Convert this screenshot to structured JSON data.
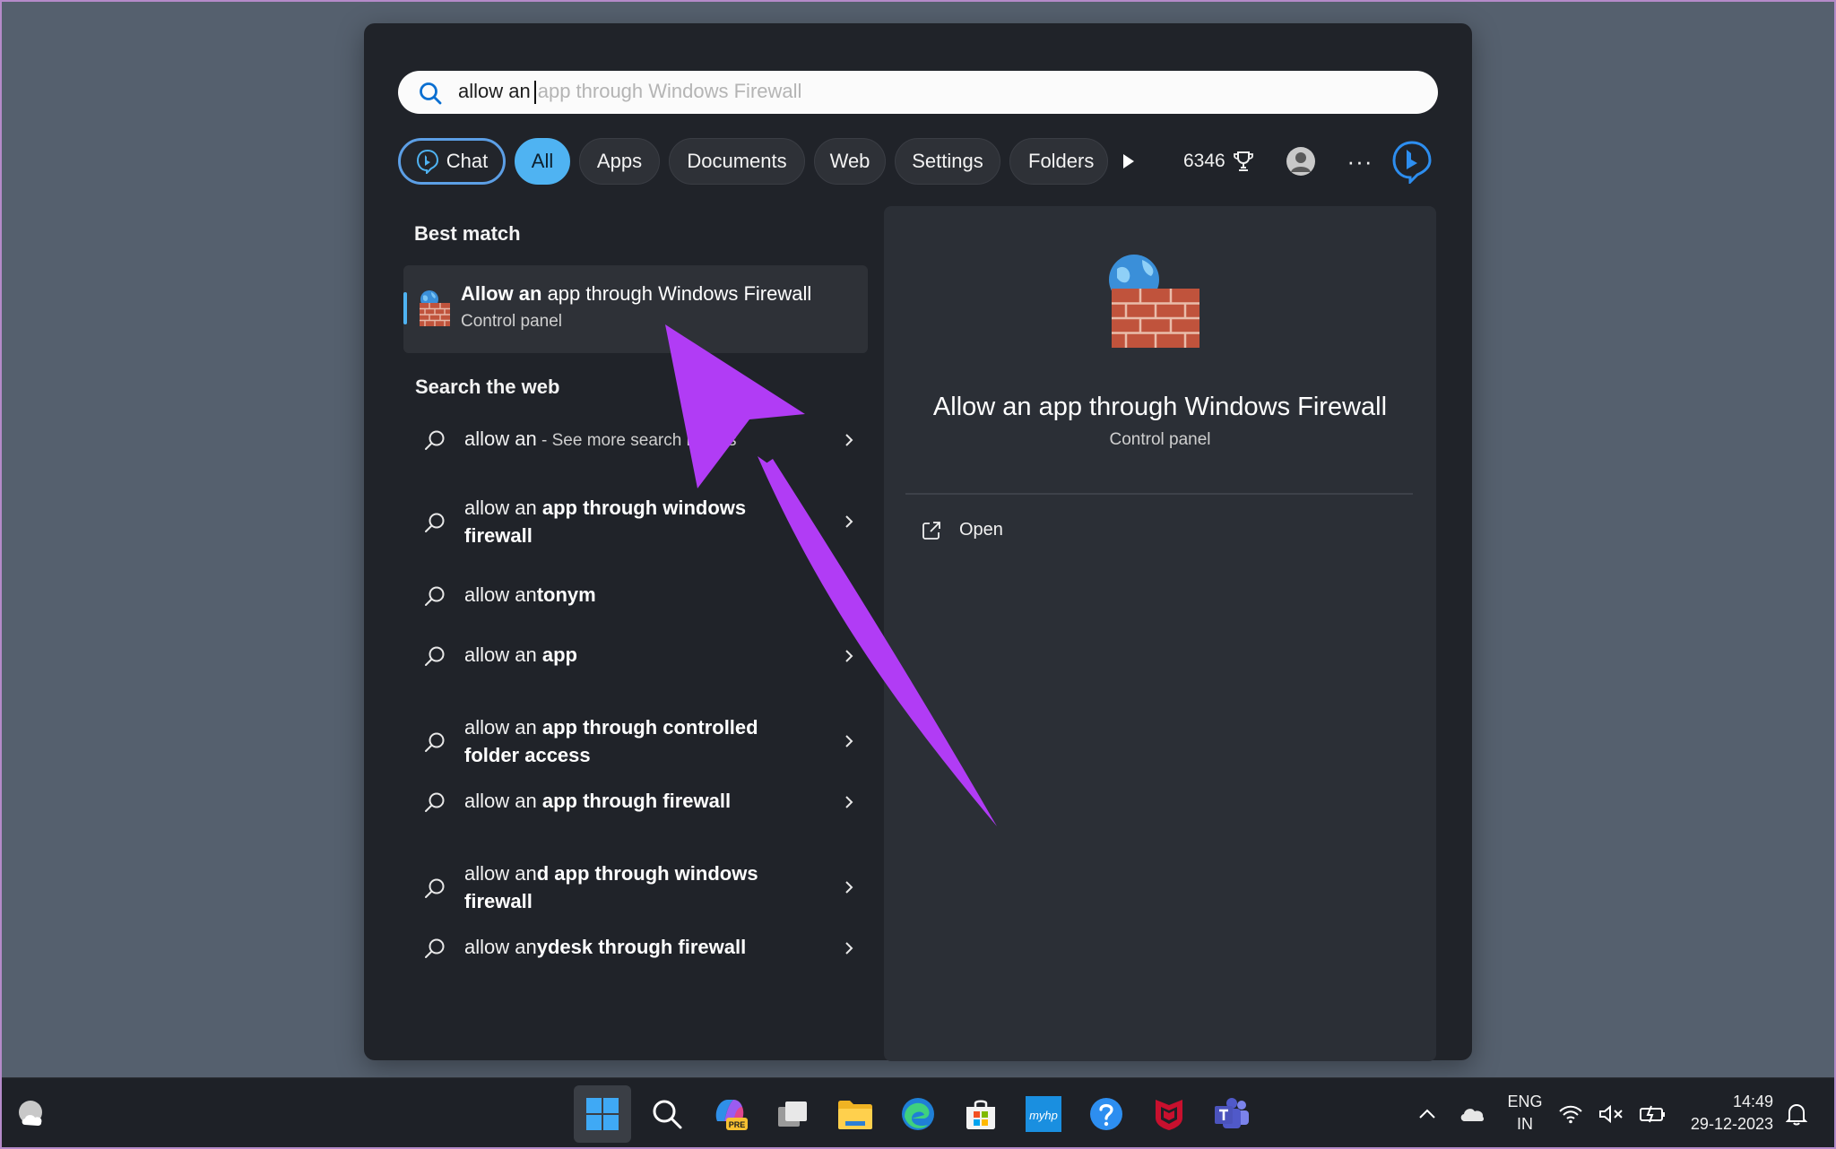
{
  "search": {
    "typed": "allow an",
    "suggestion": "app through Windows Firewall"
  },
  "filters": {
    "chat": "Chat",
    "all": "All",
    "apps": "Apps",
    "documents": "Documents",
    "web": "Web",
    "settings": "Settings",
    "folders": "Folders",
    "points": "6346"
  },
  "best_match": {
    "heading": "Best match",
    "title_bold": "Allow an",
    "title_rest": " app through Windows Firewall",
    "subtitle": "Control panel"
  },
  "web": {
    "heading": "Search the web",
    "items": [
      {
        "prefix": "allow an",
        "bold": "",
        "extra": " - See more search results"
      },
      {
        "prefix": "allow an ",
        "bold": "app through windows firewall",
        "extra": ""
      },
      {
        "prefix": "allow an",
        "bold": "tonym",
        "extra": ""
      },
      {
        "prefix": "allow an ",
        "bold": "app",
        "extra": ""
      },
      {
        "prefix": "allow an ",
        "bold": "app through controlled folder access",
        "extra": ""
      },
      {
        "prefix": "allow an ",
        "bold": "app through firewall",
        "extra": ""
      },
      {
        "prefix": "allow an",
        "bold": "d app through windows firewall",
        "extra": ""
      },
      {
        "prefix": "allow an",
        "bold": "ydesk through firewall",
        "extra": ""
      }
    ]
  },
  "preview": {
    "title": "Allow an app through Windows Firewall",
    "subtitle": "Control panel",
    "open": "Open"
  },
  "taskbar": {
    "lang": "ENG",
    "region": "IN",
    "time": "14:49",
    "date": "29-12-2023",
    "copilot_badge": "PRE",
    "hp_label": "myhp"
  },
  "colors": {
    "accent": "#4fb3f2",
    "arrow": "#b13cf5",
    "panel": "#202329",
    "desktop": "#55606e"
  }
}
